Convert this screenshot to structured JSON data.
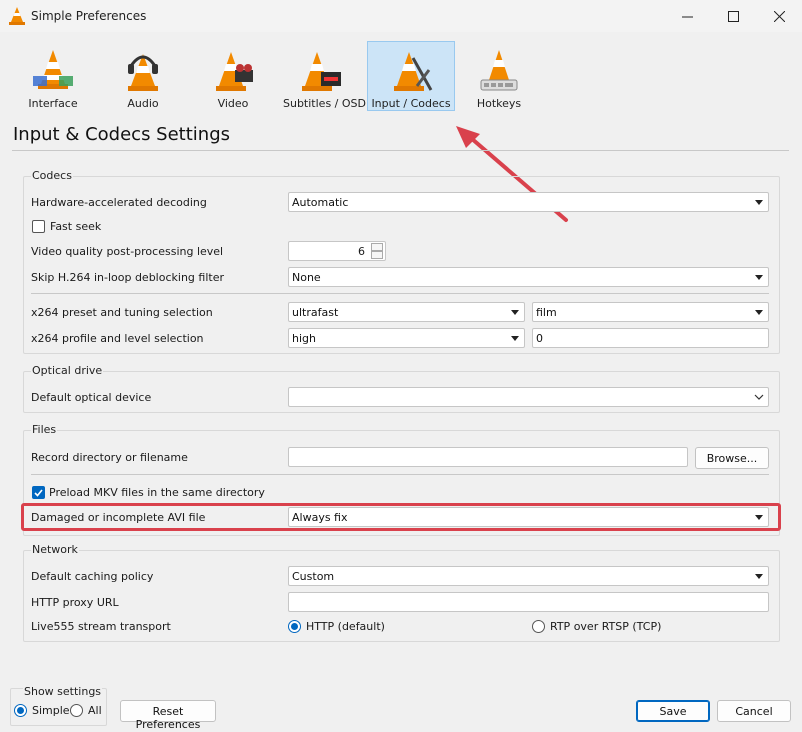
{
  "window": {
    "title": "Simple Preferences",
    "app_icon": "vlc-cone-icon"
  },
  "toolbar": {
    "items": [
      {
        "label": "Interface",
        "icon": "interface-cone-icon"
      },
      {
        "label": "Audio",
        "icon": "audio-headphones-cone-icon"
      },
      {
        "label": "Video",
        "icon": "video-cone-icon"
      },
      {
        "label": "Subtitles / OSD",
        "icon": "subtitles-cone-icon"
      },
      {
        "label": "Input / Codecs",
        "icon": "input-codecs-cone-icon"
      },
      {
        "label": "Hotkeys",
        "icon": "hotkeys-cone-icon"
      }
    ],
    "selected": "Input / Codecs"
  },
  "heading": "Input & Codecs Settings",
  "codecs": {
    "title": "Codecs",
    "hw_label": "Hardware-accelerated decoding",
    "hw_value": "Automatic",
    "fast_seek_label": "Fast seek",
    "pp_label": "Video quality post-processing level",
    "pp_value": "6",
    "skip_label": "Skip H.264 in-loop deblocking filter",
    "skip_value": "None",
    "x264_preset_label": "x264 preset and tuning selection",
    "x264_preset_value": "ultrafast",
    "x264_tune_value": "film",
    "x264_profile_label": "x264 profile and level selection",
    "x264_profile_value": "high",
    "x264_level_value": "0"
  },
  "optical": {
    "title": "Optical drive",
    "device_label": "Default optical device",
    "device_value": ""
  },
  "files": {
    "title": "Files",
    "record_label": "Record directory or filename",
    "record_value": "",
    "browse_label": "Browse...",
    "preload_label": "Preload MKV files in the same directory",
    "avi_label": "Damaged or incomplete AVI file",
    "avi_value": "Always fix"
  },
  "network": {
    "title": "Network",
    "caching_label": "Default caching policy",
    "caching_value": "Custom",
    "proxy_label": "HTTP proxy URL",
    "proxy_value": "",
    "transport_label": "Live555 stream transport",
    "transport_http": "HTTP (default)",
    "transport_rtp": "RTP over RTSP (TCP)"
  },
  "footer": {
    "show_settings": "Show settings",
    "simple": "Simple",
    "all": "All",
    "reset": "Reset Preferences",
    "save": "Save",
    "cancel": "Cancel"
  },
  "colors": {
    "accent": "#0067c0",
    "highlight": "#d9414c",
    "selected_tab": "#cce4f7"
  }
}
